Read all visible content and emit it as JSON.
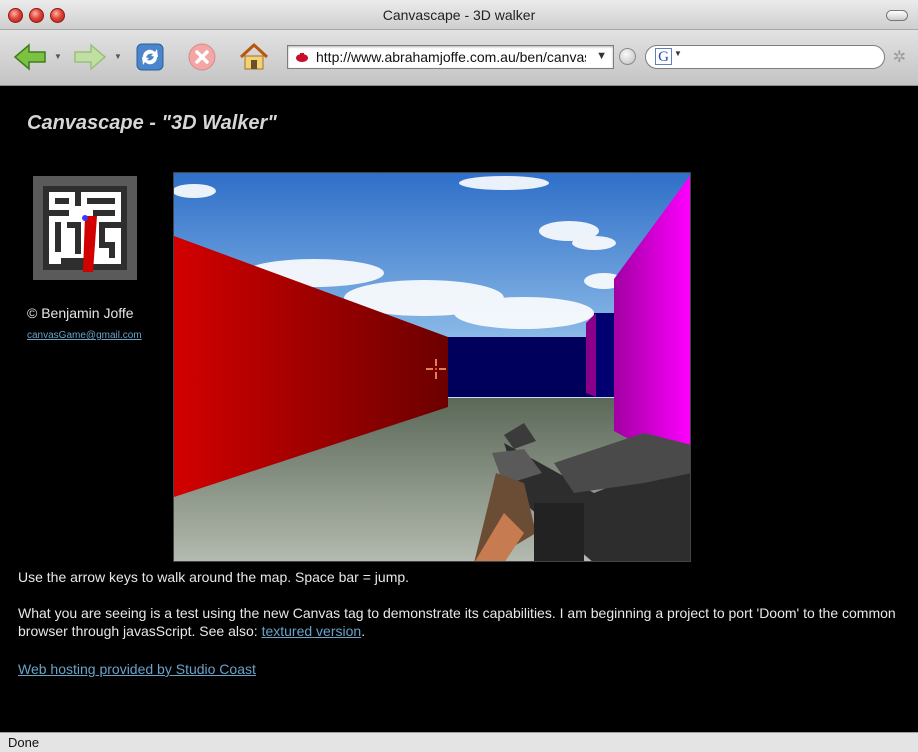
{
  "window": {
    "title": "Canvascape - 3D walker"
  },
  "toolbar": {
    "url": "http://www.abrahamjoffe.com.au/ben/canvascape/",
    "search_engine_letter": "G"
  },
  "page": {
    "title": "Canvascape - \"3D Walker\"",
    "author": "© Benjamin Joffe",
    "author_email": "canvasGame@gmail.com",
    "instructions": "Use the arrow keys to walk around the map. Space bar = jump.",
    "description_text": "What you are seeing is a test using the new Canvas tag to demonstrate its capabilities. I am beginning a project to port 'Doom' to the common browser through javasScript. See also: ",
    "textured_link": "textured version",
    "description_end": ".",
    "hosting_link": "Web hosting provided by Studio Coast"
  },
  "status": {
    "text": "Done"
  },
  "colors": {
    "traffic_close": "#e0453a",
    "link": "#6aa3c9",
    "wall_red": "#c40000",
    "wall_magenta": "#e600e6",
    "wall_navy": "#00005a",
    "floor": "#6c7668"
  },
  "icons": [
    "back-arrow-icon",
    "forward-arrow-icon",
    "reload-icon",
    "stop-icon",
    "home-icon",
    "site-favicon",
    "go-icon",
    "google-icon",
    "throbber-icon",
    "crosshair-icon"
  ]
}
